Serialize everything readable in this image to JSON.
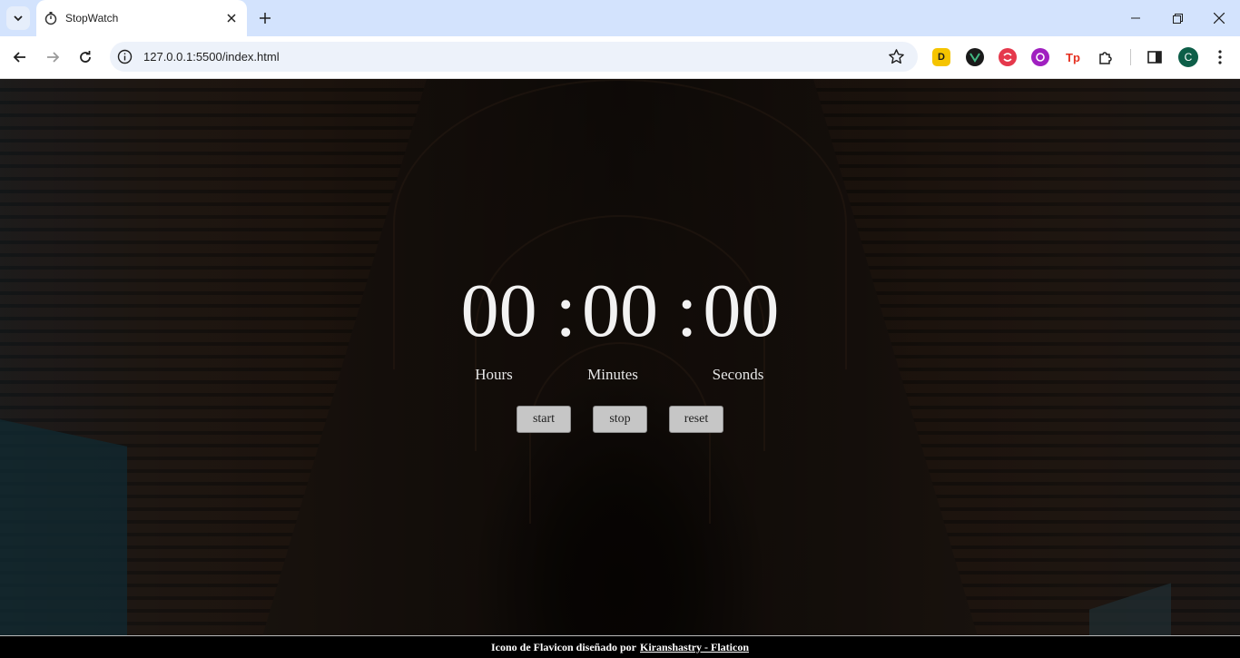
{
  "browser": {
    "tab_title": "StopWatch",
    "url": "127.0.0.1:5500/index.html",
    "profile_initial": "C",
    "extensions": [
      {
        "icon": "dashlane-d-icon",
        "label": "D",
        "color": "#f5c400"
      },
      {
        "icon": "vue-devtools-icon",
        "label": "",
        "color": "#1a1a1a"
      },
      {
        "icon": "grammar-icon",
        "label": "",
        "color": "#e5384c"
      },
      {
        "icon": "lb-extension-icon",
        "label": "",
        "color": "#a020c0"
      },
      {
        "icon": "tp-extension-icon",
        "label": "Tp",
        "color": "#e53020"
      }
    ]
  },
  "stopwatch": {
    "hours": "00",
    "minutes": "00",
    "seconds": "00",
    "separator": ":",
    "labels": {
      "hours": "Hours",
      "minutes": "Minutes",
      "seconds": "Seconds"
    },
    "buttons": {
      "start": "start",
      "stop": "stop",
      "reset": "reset"
    }
  },
  "footer": {
    "text": "Icono de Flavicon diseñado por",
    "link": "Kiranshastry - Flaticon"
  }
}
